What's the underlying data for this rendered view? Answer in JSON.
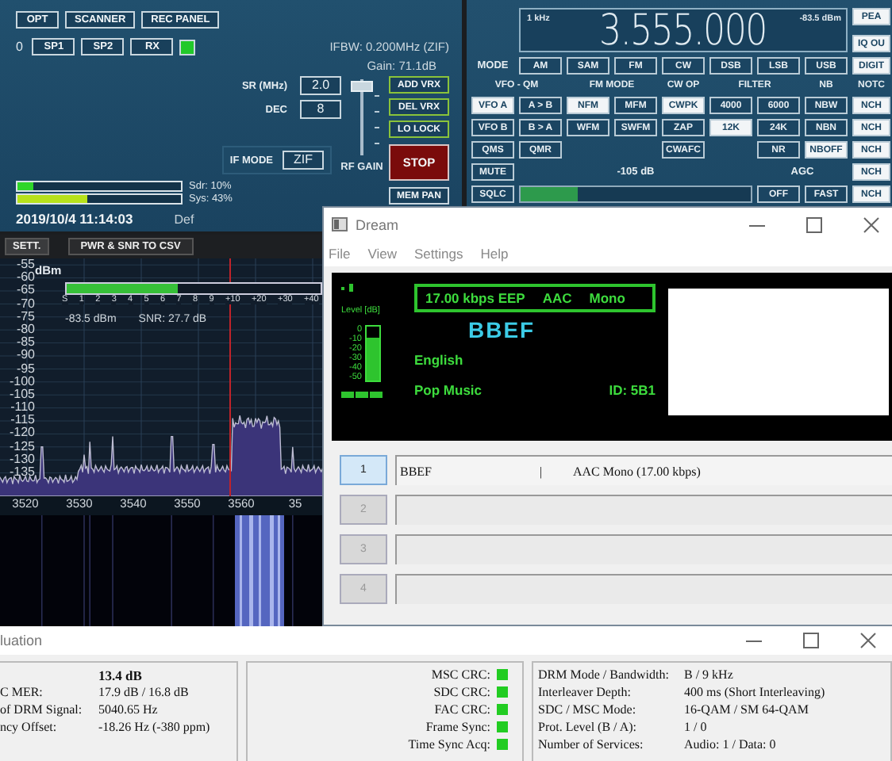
{
  "console": {
    "top_buttons": [
      "OPT",
      "SCANNER",
      "REC PANEL"
    ],
    "receiver_number": "0",
    "receiver_buttons": [
      "SP1",
      "SP2",
      "RX"
    ],
    "rx_on": true,
    "ifbw": "IFBW: 0.200MHz (ZIF)",
    "gain": "Gain: 71.1dB",
    "fields": [
      {
        "label": "SR (MHz)",
        "value": "2.0"
      },
      {
        "label": "DEC",
        "value": "8"
      }
    ],
    "rf_gain": {
      "label": "RF GAIN",
      "level": 0.97
    },
    "side_buttons": [
      {
        "label": "ADD VRX",
        "kind": "toggle"
      },
      {
        "label": "DEL VRX",
        "kind": "toggle"
      },
      {
        "label": "LO LOCK",
        "kind": "toggle"
      },
      {
        "label": "STOP",
        "kind": "stop"
      },
      {
        "label": "MEM PAN",
        "kind": "normal"
      }
    ],
    "if_mode": {
      "label": "IF MODE",
      "value": "ZIF"
    },
    "meters": [
      {
        "label": "Sdr: 10%",
        "level": 0.1
      },
      {
        "label": "Sys: 43%",
        "level": 0.43
      }
    ],
    "datetime": "2019/10/4 11:14:03",
    "profile": "Def"
  },
  "radio": {
    "scale": "1 kHz",
    "frequency": "3.555.000",
    "level": "-83.5 dBm",
    "corner_buttons": [
      {
        "label": "PEA",
        "selected": true
      },
      {
        "label": "IQ OU",
        "selected": true
      }
    ],
    "mode_label": "MODE",
    "modes": [
      {
        "label": "AM",
        "selected": false
      },
      {
        "label": "SAM",
        "selected": false
      },
      {
        "label": "FM",
        "selected": false
      },
      {
        "label": "CW",
        "selected": false
      },
      {
        "label": "DSB",
        "selected": false
      },
      {
        "label": "LSB",
        "selected": false
      },
      {
        "label": "USB",
        "selected": false
      }
    ],
    "digital": {
      "label": "DIGIT",
      "selected": true
    },
    "headings": [
      "VFO - QM",
      "FM MODE",
      "CW OP",
      "FILTER",
      "NB"
    ],
    "notch_heading": "NOTC",
    "rows": [
      [
        {
          "kind": "button",
          "label": "VFO A",
          "selected": true
        },
        {
          "kind": "button",
          "label": "A > B",
          "selected": false
        },
        {
          "kind": "button",
          "label": "NFM",
          "selected": true
        },
        {
          "kind": "button",
          "label": "MFM",
          "selected": false
        },
        {
          "kind": "button",
          "label": "CWPK",
          "selected": true
        },
        {
          "kind": "button",
          "label": "4000",
          "selected": false
        },
        {
          "kind": "button",
          "label": "6000",
          "selected": false
        },
        {
          "kind": "button",
          "label": "NBW",
          "selected": false
        }
      ],
      [
        {
          "kind": "button",
          "label": "VFO B",
          "selected": false
        },
        {
          "kind": "button",
          "label": "B > A",
          "selected": false
        },
        {
          "kind": "button",
          "label": "WFM",
          "selected": false
        },
        {
          "kind": "button",
          "label": "SWFM",
          "selected": false
        },
        {
          "kind": "button",
          "label": "ZAP",
          "selected": false
        },
        {
          "kind": "button",
          "label": "12K",
          "selected": true
        },
        {
          "kind": "button",
          "label": "24K",
          "selected": false
        },
        {
          "kind": "button",
          "label": "NBN",
          "selected": false
        }
      ],
      [
        {
          "kind": "button",
          "label": "QMS",
          "selected": false
        },
        {
          "kind": "button",
          "label": "QMR",
          "selected": false
        },
        {
          "kind": "gap"
        },
        {
          "kind": "gap"
        },
        {
          "kind": "button",
          "label": "CWAFC",
          "selected": false
        },
        {
          "kind": "gap"
        },
        {
          "kind": "button",
          "label": "NR",
          "selected": false
        },
        {
          "kind": "button",
          "label": "NBOFF",
          "selected": true
        }
      ]
    ],
    "notch_buttons": [
      {
        "label": "NCH",
        "selected": true
      },
      {
        "label": "NCH",
        "selected": true
      },
      {
        "label": "NCH",
        "selected": true
      },
      {
        "label": "NCH",
        "selected": true
      },
      {
        "label": "NCH",
        "selected": true
      }
    ],
    "mute": {
      "label": "MUTE",
      "selected": false
    },
    "squelch_button": {
      "label": "SQLC",
      "selected": false
    },
    "squelch": {
      "reading": "-105 dB",
      "level": 0.25
    },
    "agc": {
      "label": "AGC",
      "buttons": [
        {
          "label": "OFF",
          "selected": false
        },
        {
          "label": "FAST",
          "selected": false
        }
      ]
    }
  },
  "spectrum": {
    "buttons": [
      "SETT.",
      "PWR & SNR TO CSV"
    ],
    "unit": "dBm",
    "y_labels": [
      "-55",
      "-60",
      "-65",
      "-70",
      "-75",
      "-80",
      "-85",
      "-90",
      "-95",
      "-100",
      "-105",
      "-110",
      "-115",
      "-120",
      "-125",
      "-130",
      "-135"
    ],
    "s_scale": [
      "S",
      "1",
      "2",
      "3",
      "4",
      "5",
      "6",
      "7",
      "8",
      "9",
      "+10",
      "+20",
      "+30",
      "+40"
    ],
    "s_meter": {
      "level": 0.44
    },
    "power": "-83.5 dBm",
    "snr": "SNR: 27.7 dB",
    "x_labels": [
      "3520",
      "3530",
      "3540",
      "3550",
      "3560",
      "35"
    ]
  },
  "dream": {
    "title": "Dream",
    "menu": [
      "File",
      "View",
      "Settings",
      "Help"
    ],
    "level_label": "Level [dB]",
    "level_scale": [
      "0",
      "-10",
      "-20",
      "-30",
      "-40",
      "-50"
    ],
    "audio": {
      "level": 0.8
    },
    "bitrate": "17.00 kbps EEP",
    "codec": "AAC",
    "channels": "Mono",
    "station": "BBEF",
    "language": "English",
    "genre": "Pop Music",
    "id": "ID: 5B1",
    "services": [
      {
        "number": "1",
        "selected": true,
        "disabled": false,
        "label": "BBEF",
        "separator": "|",
        "description": "AAC Mono (17.00 kbps)"
      },
      {
        "number": "2",
        "selected": false,
        "disabled": true
      },
      {
        "number": "3",
        "selected": false,
        "disabled": true
      },
      {
        "number": "4",
        "selected": false,
        "disabled": true
      }
    ]
  },
  "evaluation": {
    "title": "luation",
    "left_rows": [
      {
        "value": "13.4 dB"
      },
      {
        "label": "C MER:",
        "value": "17.9 dB / 16.8 dB"
      },
      {
        "label": "of DRM Signal:",
        "value": "5040.65 Hz"
      },
      {
        "label": "ncy Offset:",
        "value": "-18.26 Hz (-380 ppm)"
      }
    ],
    "crc": [
      {
        "label": "MSC CRC:",
        "ok": true
      },
      {
        "label": "SDC CRC:",
        "ok": true
      },
      {
        "label": "FAC CRC:",
        "ok": true
      },
      {
        "label": "Frame Sync:",
        "ok": true
      },
      {
        "label": "Time Sync Acq:",
        "ok": true
      }
    ],
    "right_rows": [
      {
        "label": "DRM Mode / Bandwidth:",
        "value": "B / 9 kHz"
      },
      {
        "label": "Interleaver Depth:",
        "value": "400 ms (Short Interleaving)"
      },
      {
        "label": "SDC / MSC Mode:",
        "value": "16-QAM / SM 64-QAM"
      },
      {
        "label": "Prot. Level (B / A):",
        "value": "1 / 0"
      },
      {
        "label": "Number of Services:",
        "value": "Audio: 1 / Data: 0"
      }
    ]
  }
}
